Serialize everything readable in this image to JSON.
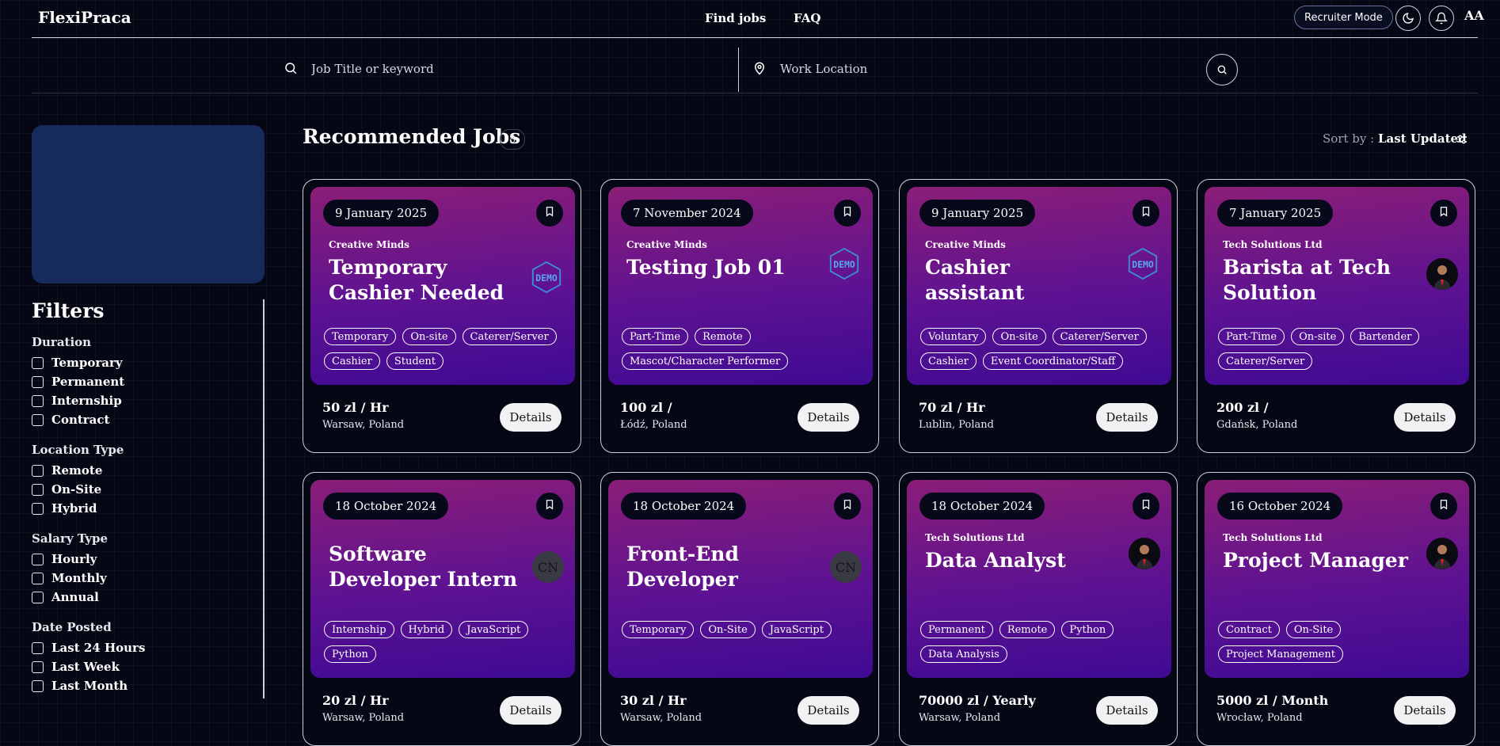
{
  "header": {
    "logo": "FlexiPraca",
    "nav": [
      "Find jobs",
      "FAQ"
    ],
    "recruiter_mode": "Recruiter Mode",
    "font_size_toggle": "AA"
  },
  "search": {
    "keyword_placeholder": "Job Title or keyword",
    "location_placeholder": "Work Location"
  },
  "sidebar": {
    "title": "Filters",
    "groups": [
      {
        "title": "Duration",
        "options": [
          "Temporary",
          "Permanent",
          "Internship",
          "Contract"
        ]
      },
      {
        "title": "Location Type",
        "options": [
          "Remote",
          "On-Site",
          "Hybrid"
        ]
      },
      {
        "title": "Salary Type",
        "options": [
          "Hourly",
          "Monthly",
          "Annual"
        ]
      },
      {
        "title": "Date Posted",
        "options": [
          "Last 24 Hours",
          "Last Week",
          "Last Month"
        ]
      }
    ]
  },
  "main": {
    "title": "Recommended Jobs",
    "count": "8",
    "sort_label": "Sort by :",
    "sort_value": "Last Updated",
    "details_label": "Details",
    "jobs": [
      {
        "date": "9 January 2025",
        "company": "Creative Minds",
        "title": "Temporary Cashier Needed",
        "logo": "demo",
        "tags": [
          "Temporary",
          "On-site",
          "Caterer/Server",
          "Cashier",
          "Student"
        ],
        "salary": "50 zl / Hr",
        "location": "Warsaw, Poland"
      },
      {
        "date": "7 November 2024",
        "company": "Creative Minds",
        "title": "Testing Job 01",
        "logo": "demo",
        "tags": [
          "Part-Time",
          "Remote",
          "Mascot/Character Performer"
        ],
        "salary": "100 zl /",
        "location": "Łódź, Poland"
      },
      {
        "date": "9 January 2025",
        "company": "Creative Minds",
        "title": "Cashier assistant",
        "logo": "demo",
        "tags": [
          "Voluntary",
          "On-site",
          "Caterer/Server",
          "Cashier",
          "Event Coordinator/Staff"
        ],
        "salary": "70 zl / Hr",
        "location": "Lublin, Poland"
      },
      {
        "date": "7 January 2025",
        "company": "Tech Solutions Ltd",
        "title": "Barista at Tech Solution",
        "logo": "avatar",
        "tags": [
          "Part-Time",
          "On-site",
          "Bartender",
          "Caterer/Server"
        ],
        "salary": "200 zl /",
        "location": "Gdańsk, Poland"
      },
      {
        "date": "18 October 2024",
        "company": "",
        "title": "Software Developer Intern",
        "logo": "cn",
        "logo_text": "CN",
        "tags": [
          "Internship",
          "Hybrid",
          "JavaScript",
          "Python"
        ],
        "salary": "20 zl / Hr",
        "location": "Warsaw, Poland"
      },
      {
        "date": "18 October 2024",
        "company": "",
        "title": "Front-End Developer",
        "logo": "cn",
        "logo_text": "CN",
        "tags": [
          "Temporary",
          "On-Site",
          "JavaScript"
        ],
        "salary": "30 zl / Hr",
        "location": "Warsaw, Poland"
      },
      {
        "date": "18 October 2024",
        "company": "Tech Solutions Ltd",
        "title": "Data Analyst",
        "logo": "avatar",
        "tags": [
          "Permanent",
          "Remote",
          "Python",
          "Data Analysis"
        ],
        "salary": "70000 zl / Yearly",
        "location": "Warsaw, Poland"
      },
      {
        "date": "16 October 2024",
        "company": "Tech Solutions Ltd",
        "title": "Project Manager",
        "logo": "avatar",
        "tags": [
          "Contract",
          "On-Site",
          "Project Management"
        ],
        "salary": "5000 zl / Month",
        "location": "Wrocław, Poland"
      }
    ]
  }
}
